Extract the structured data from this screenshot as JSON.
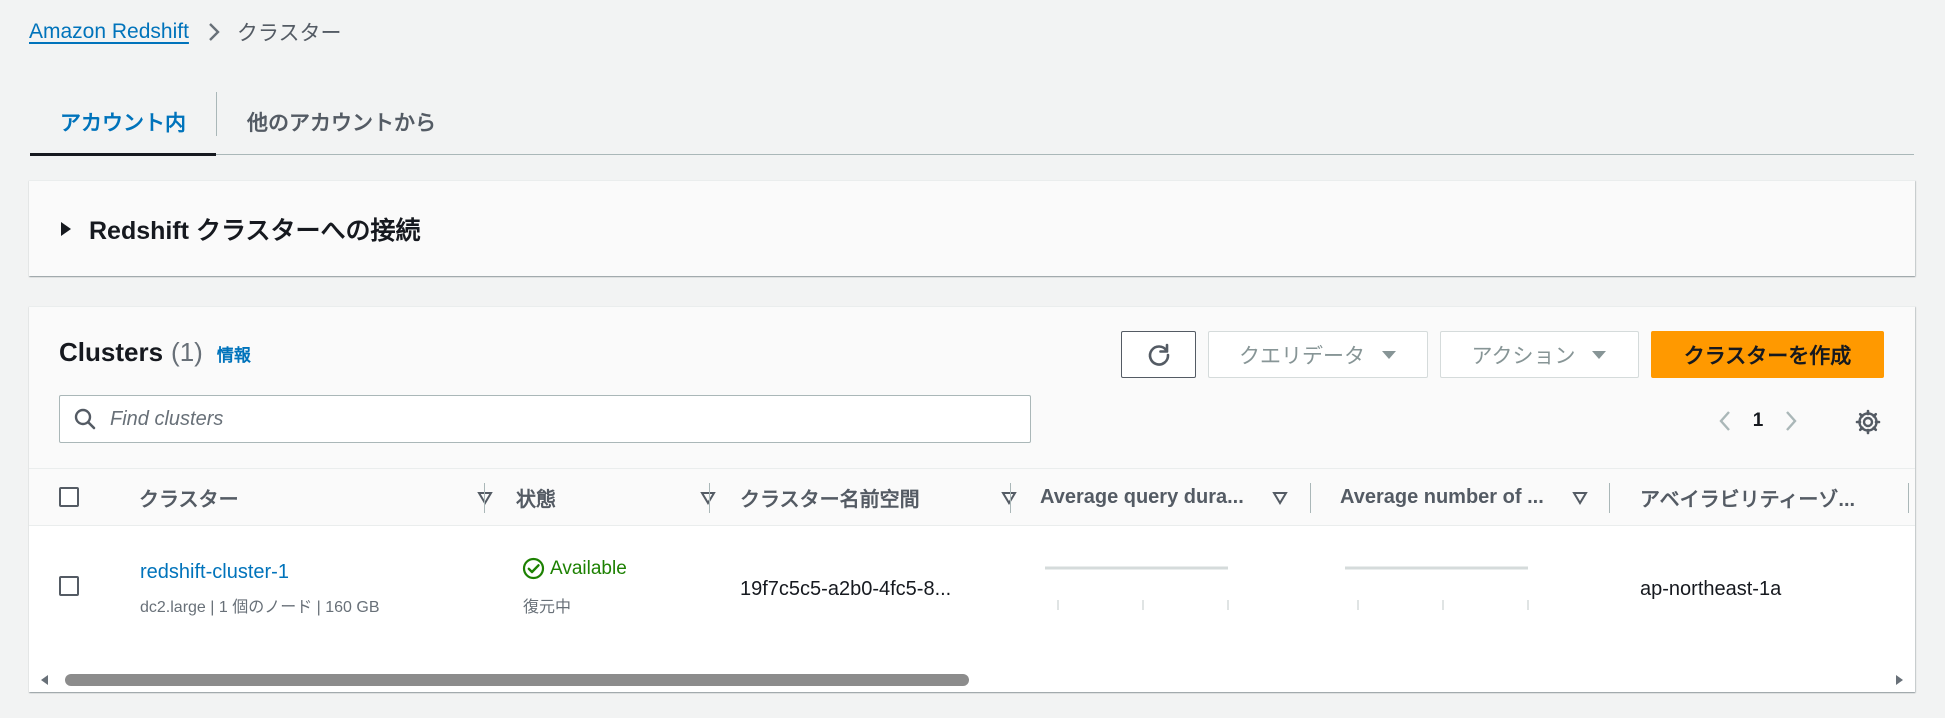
{
  "breadcrumb": {
    "root": "Amazon Redshift",
    "current": "クラスター"
  },
  "tabs": [
    {
      "label": "アカウント内",
      "active": true
    },
    {
      "label": "他のアカウントから",
      "active": false
    }
  ],
  "connect_panel": {
    "title": "Redshift クラスターへの接続",
    "expanded": false
  },
  "clusters": {
    "title": "Clusters",
    "count": "(1)",
    "info_link": "情報",
    "buttons": {
      "refresh": "refresh-icon",
      "query_editor": "クエリデータ",
      "actions": "アクション",
      "create": "クラスターを作成"
    },
    "search": {
      "placeholder": "Find clusters",
      "value": ""
    },
    "pagination": {
      "current_page": "1"
    },
    "columns": [
      "クラスター",
      "状態",
      "クラスター名前空間",
      "Average query dura...",
      "Average number of ...",
      "アベイラビリティーゾ..."
    ],
    "rows": [
      {
        "name": "redshift-cluster-1",
        "details": "dc2.large | 1 個のノード | 160 GB",
        "status": "Available",
        "status_sub": "復元中",
        "namespace": "19f7c5c5-a2b0-4fc5-8...",
        "availability_zone": "ap-northeast-1a"
      }
    ]
  },
  "colors": {
    "link": "#0073bb",
    "primary": "#ff9900",
    "success": "#1d8102",
    "background": "#f2f3f3"
  }
}
